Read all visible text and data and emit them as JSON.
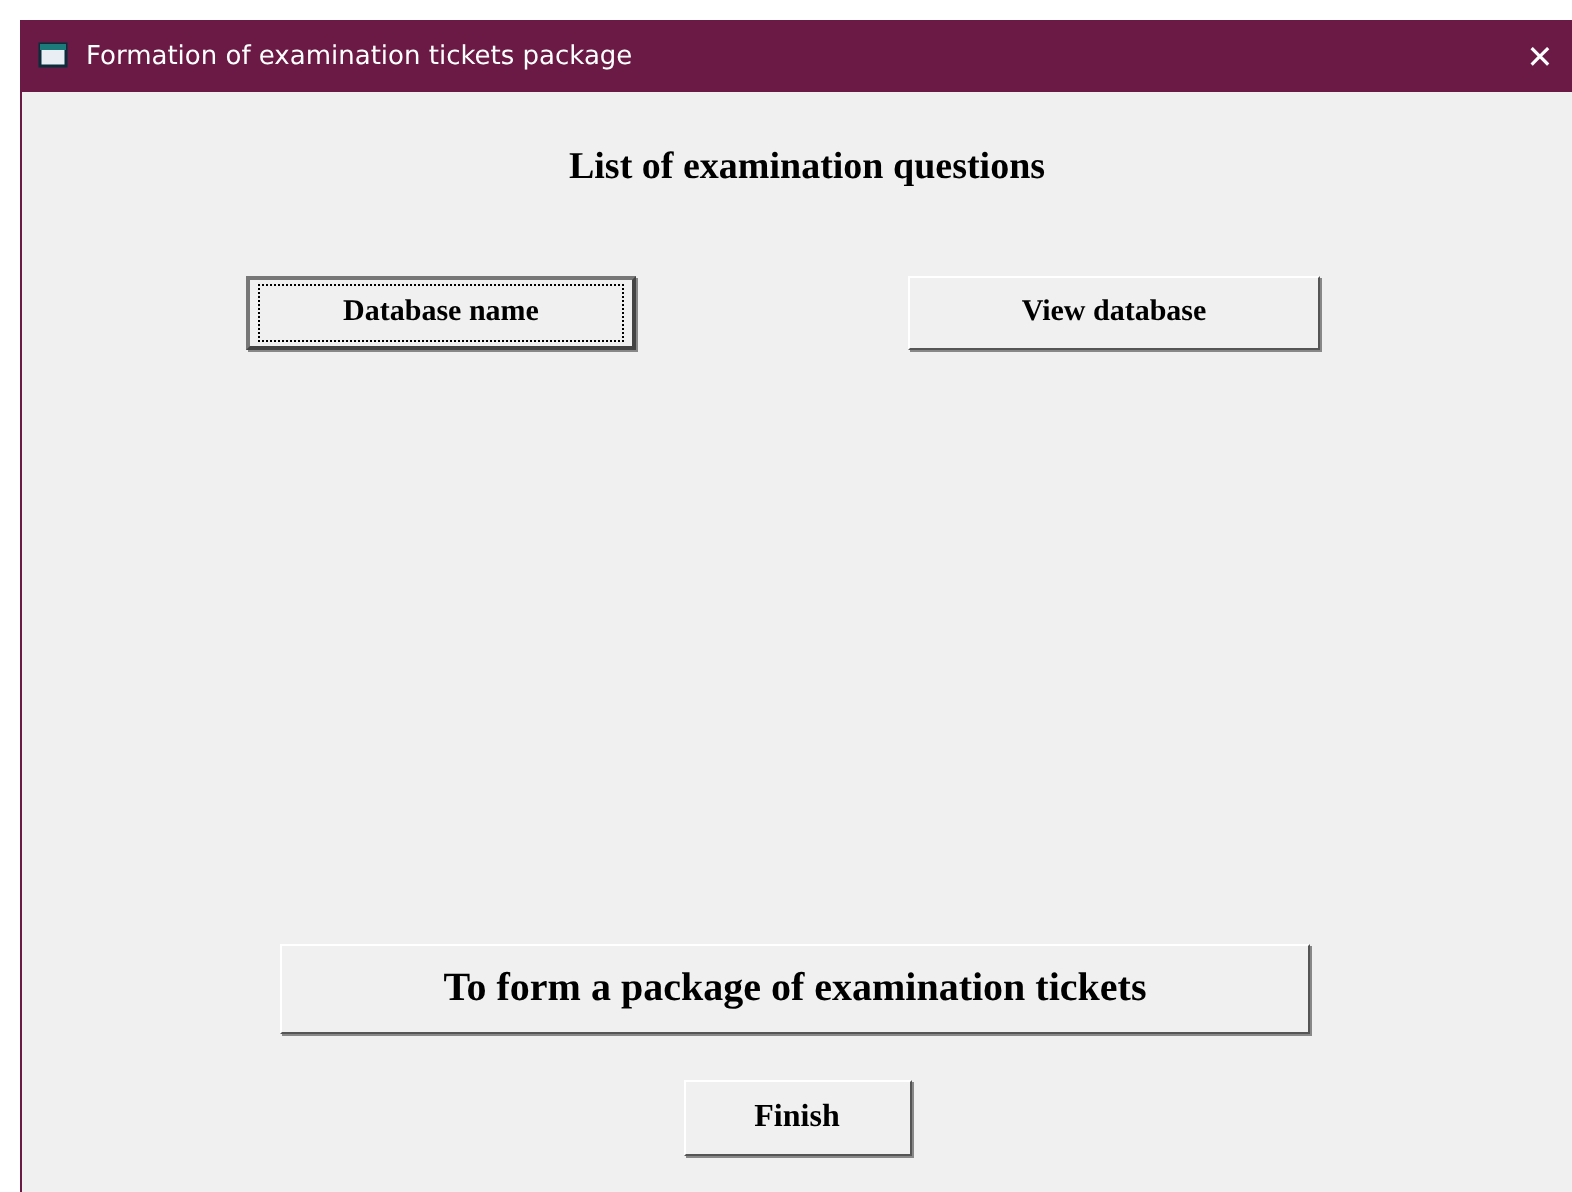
{
  "window": {
    "title": "Formation of examination tickets package",
    "close": "✕"
  },
  "heading": "List of examination questions",
  "top_buttons": [
    {
      "label": "Database name",
      "focused": true
    },
    {
      "label": "View database",
      "focused": false
    }
  ],
  "main_button": {
    "label": "To form a package of examination tickets",
    "focused": false
  },
  "finish_button": {
    "label": "Finish",
    "focused": false
  }
}
